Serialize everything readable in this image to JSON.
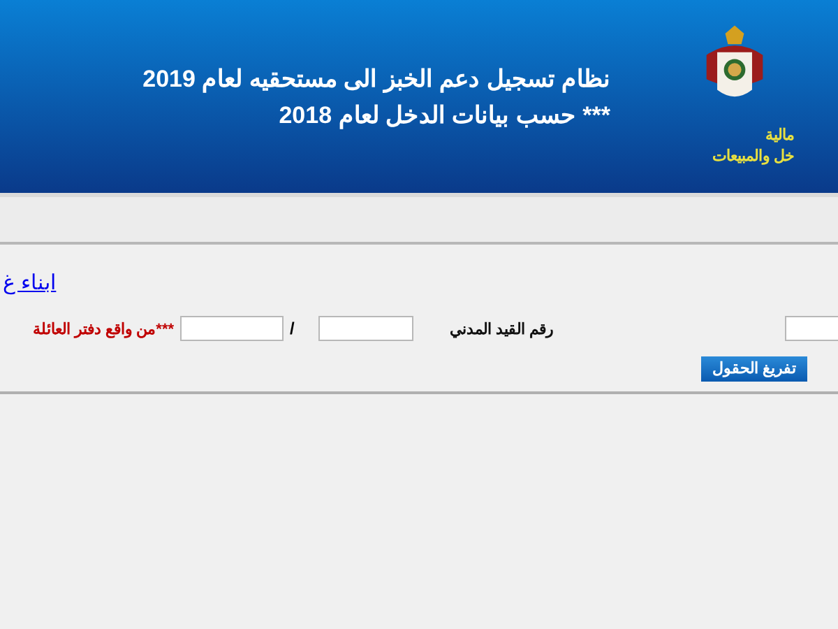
{
  "header": {
    "title_lines": [
      "نظام تسجيل دعم الخبز الى مستحقيه لعام 2019",
      "***  حسب بيانات الدخل لعام 2018"
    ],
    "logo_lines": [
      "مالية",
      "خل والمبيعات"
    ]
  },
  "form": {
    "link": "ابناء غ",
    "national_id_label": "رقم القيد المدني",
    "family_book_label": "***من واقع دفتر العائلة",
    "separator": "/",
    "clear_button": "تفريغ الحقول"
  }
}
